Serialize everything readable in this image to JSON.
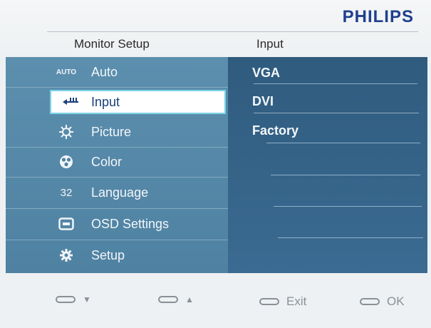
{
  "brand": "PHILIPS",
  "header": {
    "left_title": "Monitor Setup",
    "right_title": "Input"
  },
  "menu": [
    {
      "icon": "auto-icon",
      "icon_text": "AUTO",
      "label": "Auto"
    },
    {
      "icon": "input-icon",
      "label": "Input",
      "selected": true
    },
    {
      "icon": "picture-icon",
      "label": "Picture"
    },
    {
      "icon": "color-icon",
      "label": "Color"
    },
    {
      "icon": "language-icon",
      "icon_text": "32",
      "label": "Language"
    },
    {
      "icon": "osd-settings-icon",
      "label": "OSD Settings"
    },
    {
      "icon": "setup-icon",
      "label": "Setup"
    }
  ],
  "submenu": [
    "VGA",
    "DVI",
    "Factory"
  ],
  "controls": [
    {
      "icon": "down-arrow-icon",
      "label": "▼"
    },
    {
      "icon": "up-arrow-icon",
      "label": "▲"
    },
    {
      "icon": "exit-button-icon",
      "label": "Exit"
    },
    {
      "icon": "ok-button-icon",
      "label": "OK"
    }
  ],
  "colors": {
    "brand": "#1f3f8e",
    "panel_left": "#4f82a2",
    "panel_right": "#2f5b7e",
    "selected_border": "#7dd3e6"
  }
}
